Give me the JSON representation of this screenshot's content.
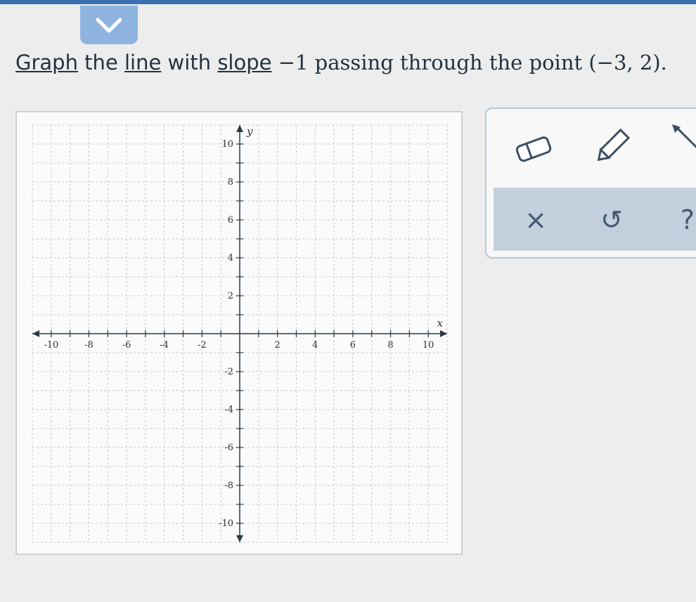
{
  "header": {
    "collapse_icon": "chevron-down-icon",
    "accent_color": "#8fb3df"
  },
  "prompt": {
    "w1": "Graph",
    "w2": " the ",
    "w3": "line",
    "w4": " with ",
    "w5": "slope",
    "w6": " −1 passing through the point (−3, 2)."
  },
  "graph": {
    "x_axis_label": "x",
    "y_axis_label": "y",
    "x_range": [
      -10,
      10
    ],
    "y_range": [
      -10,
      10
    ],
    "grid": true,
    "x_tick_labels": [
      "-10",
      "-8",
      "-6",
      "-4",
      "-2",
      "2",
      "4",
      "6",
      "8",
      "10"
    ],
    "y_tick_labels": [
      "10",
      "8",
      "6",
      "4",
      "2",
      "-2",
      "-4",
      "-6",
      "-8",
      "-10"
    ]
  },
  "tools": {
    "eraser": "eraser-icon",
    "pencil": "pencil-icon",
    "line": "line-tool-icon"
  },
  "actions": {
    "clear": "×",
    "undo": "↺",
    "help": "?"
  }
}
